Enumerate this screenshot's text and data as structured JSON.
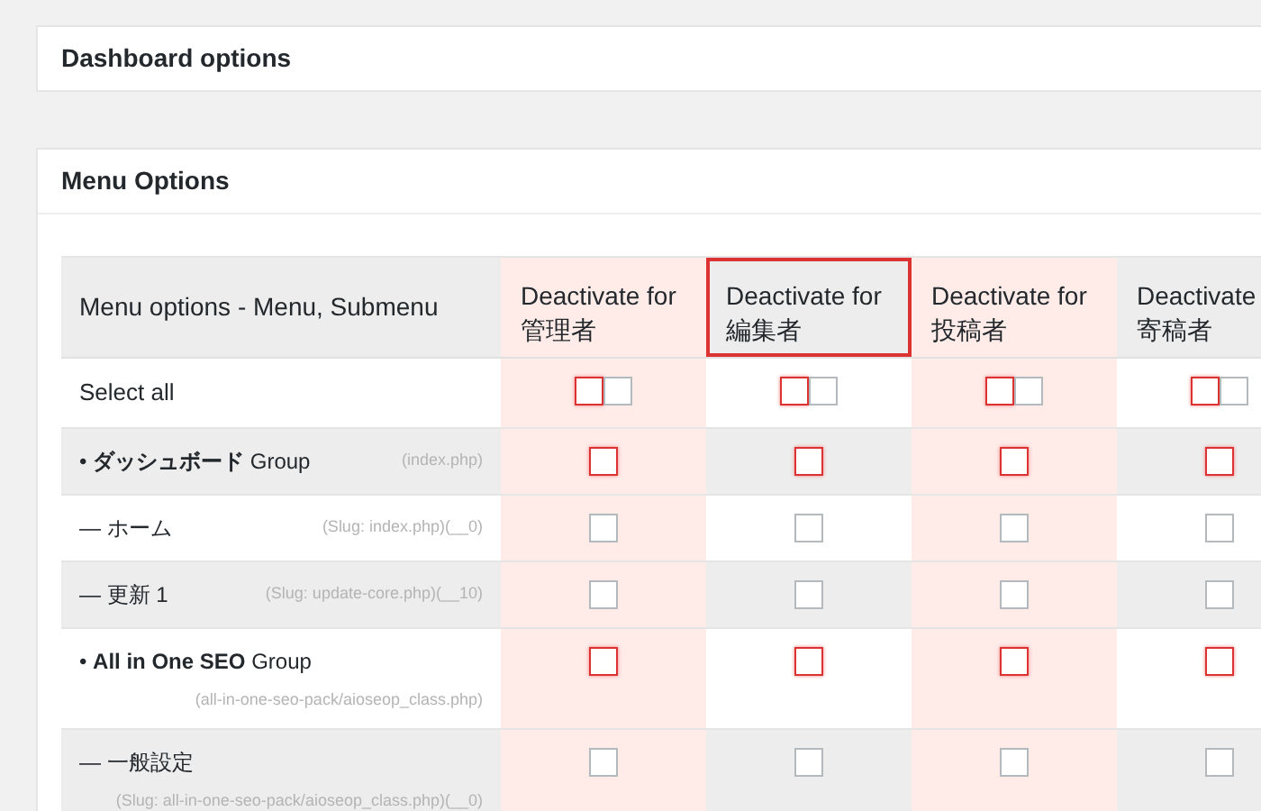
{
  "panels": [
    {
      "title": "Dashboard options"
    },
    {
      "title": "Menu Options"
    }
  ],
  "table": {
    "corner": "Menu options - Menu, Submenu",
    "columns": [
      {
        "lines": [
          "Deactivate for",
          "管理者"
        ],
        "highlighted": false
      },
      {
        "lines": [
          "Deactivate for",
          "編集者"
        ],
        "highlighted": true
      },
      {
        "lines": [
          "Deactivate for",
          "投稿者"
        ],
        "highlighted": false
      },
      {
        "lines": [
          "Deactivate",
          "寄稿者"
        ],
        "highlighted": false
      }
    ],
    "rows": [
      {
        "kind": "select_all",
        "label": "Select all",
        "checked": [
          [
            false,
            false
          ],
          [
            false,
            false
          ],
          [
            false,
            false
          ],
          [
            false,
            false
          ]
        ]
      },
      {
        "kind": "group",
        "label": "• **ダッシュボード** Group",
        "slug": "(index.php)",
        "checked": [
          [
            false
          ],
          [
            false
          ],
          [
            false
          ],
          [
            false
          ]
        ]
      },
      {
        "kind": "item",
        "label": "— ホーム",
        "slug": "(Slug: index.php)(__0)",
        "checked": [
          [
            false
          ],
          [
            false
          ],
          [
            false
          ],
          [
            false
          ]
        ]
      },
      {
        "kind": "item",
        "label": "— 更新 1",
        "slug": "(Slug: update-core.php)(__10)",
        "checked": [
          [
            false
          ],
          [
            false
          ],
          [
            false
          ],
          [
            false
          ]
        ]
      },
      {
        "kind": "group",
        "label": "• **All in One SEO** Group",
        "slug": "(all-in-one-seo-pack/aioseop_class.php)",
        "checked": [
          [
            false
          ],
          [
            false
          ],
          [
            false
          ],
          [
            false
          ]
        ]
      },
      {
        "kind": "item",
        "label": "— 一般設定",
        "slug": "(Slug: all-in-one-seo-pack/aioseop_class.php)(__0)",
        "checked": [
          [
            false
          ],
          [
            false
          ],
          [
            false
          ],
          [
            false
          ]
        ]
      }
    ]
  }
}
